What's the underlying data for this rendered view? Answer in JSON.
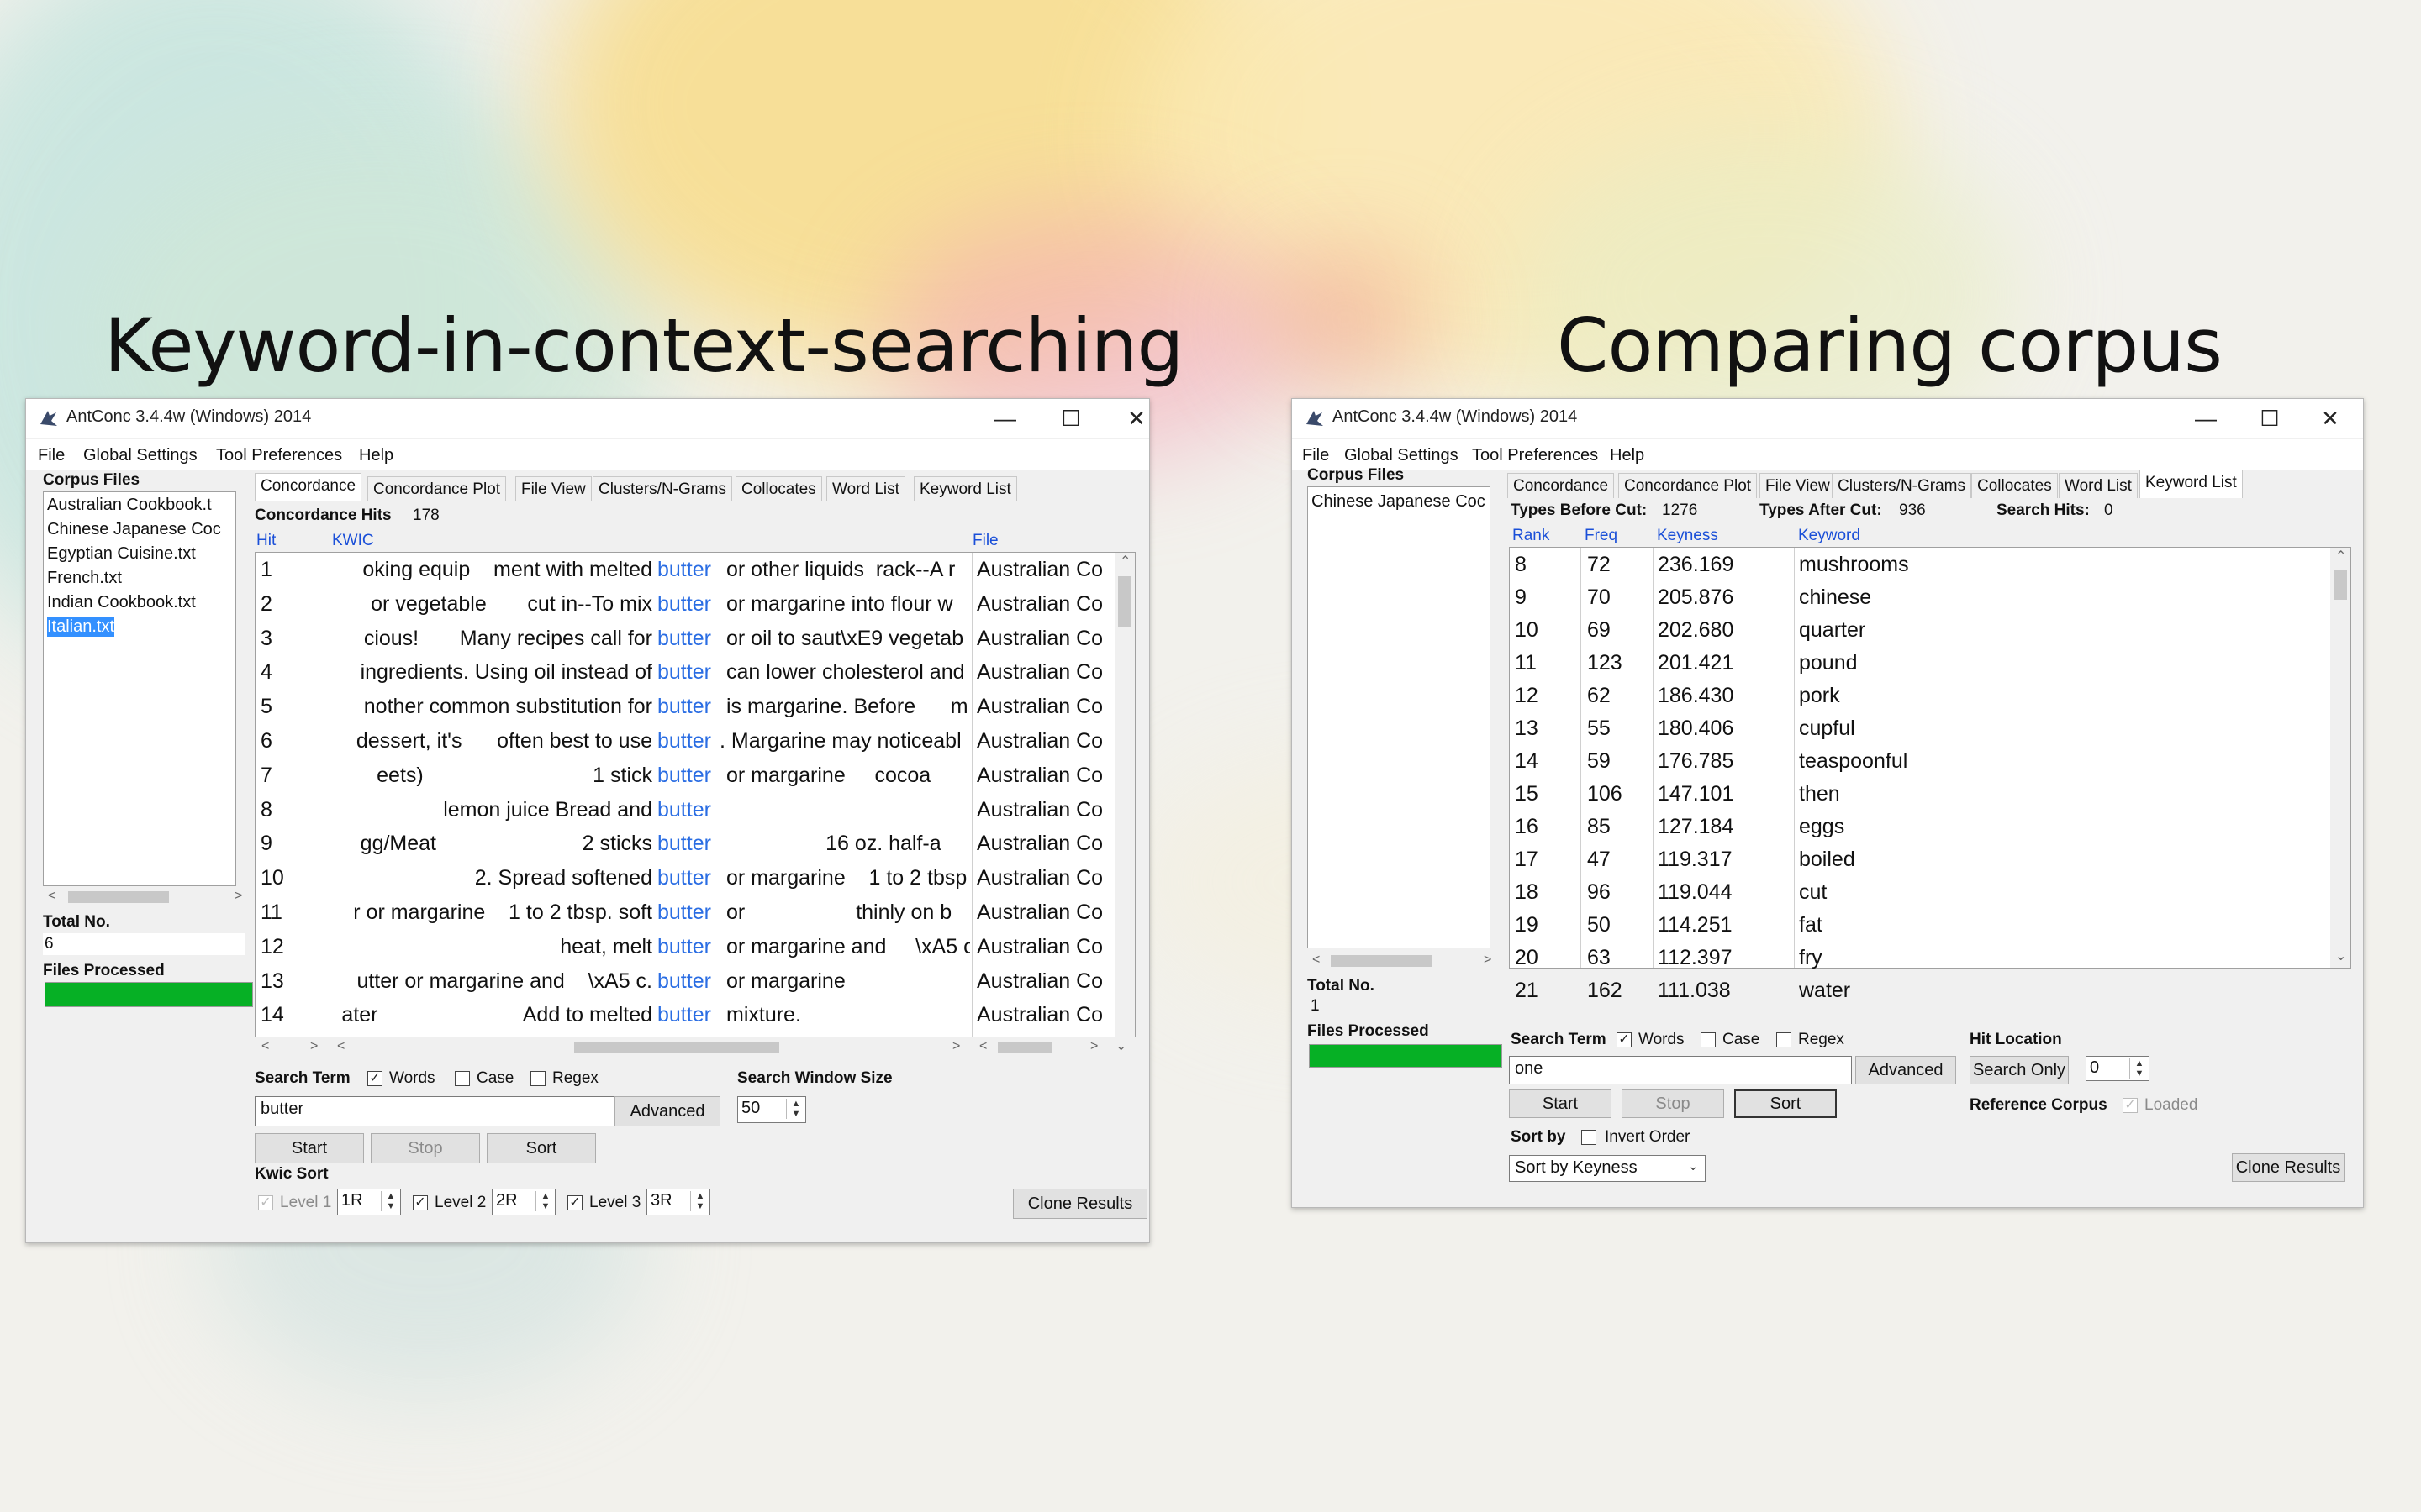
{
  "slide": {
    "left_title": "Keyword-in-context-searching",
    "right_title": "Comparing corpus"
  },
  "colors": {
    "progress": "#06b025",
    "selection": "#3390ff",
    "keyword": "#2a6de3",
    "column_header": "#1a4fd8"
  },
  "left_window": {
    "title": "AntConc 3.4.4w (Windows) 2014",
    "menu": [
      "File",
      "Global Settings",
      "Tool Preferences",
      "Help"
    ],
    "corpus_files_label": "Corpus Files",
    "corpus_files": [
      "Australian Cookbook.t",
      "Chinese Japanese Coc",
      "Egyptian Cuisine.txt",
      "French.txt",
      "Indian Cookbook.txt",
      "Italian.txt"
    ],
    "selected_file": "Italian.txt",
    "total_no_label": "Total No.",
    "total_no": "6",
    "files_processed_label": "Files Processed",
    "files_processed_progress": 1.0,
    "tabs": [
      "Concordance",
      "Concordance Plot",
      "File View",
      "Clusters/N-Grams",
      "Collocates",
      "Word List",
      "Keyword List"
    ],
    "active_tab": "Concordance",
    "hits_label": "Concordance Hits",
    "hits": "178",
    "columns": {
      "hit": "Hit",
      "kwic": "KWIC",
      "file": "File"
    },
    "rows": [
      {
        "hit": "1",
        "left": "oking equip    ment with melted",
        "kw": "butter",
        "right": "or other liquids  rack--A r",
        "file": "Australian Co"
      },
      {
        "hit": "2",
        "left": "or vegetable       cut in--To mix",
        "kw": "butter",
        "right": "or margarine into flour w",
        "file": "Australian Co"
      },
      {
        "hit": "3",
        "left": "cious!       Many recipes call for",
        "kw": "butter",
        "right": "or oil to saut\\xE9 vegetab",
        "file": "Australian Co"
      },
      {
        "hit": "4",
        "left": "ingredients. Using oil instead of",
        "kw": "butter",
        "right": "can lower cholesterol and",
        "file": "Australian Co"
      },
      {
        "hit": "5",
        "left": "nother common substitution for",
        "kw": "butter",
        "right": "is margarine. Before      m",
        "file": "Australian Co"
      },
      {
        "hit": "6",
        "left": "dessert, it's      often best to use",
        "kw": "butter",
        "right": ". Margarine may noticeabl",
        "file": "Australian Co"
      },
      {
        "hit": "7",
        "left": "eets)                             1 stick",
        "kw": "butter",
        "right": "or margarine     cocoa",
        "file": "Australian Co"
      },
      {
        "hit": "8",
        "left": "lemon juice Bread and",
        "kw": "butter",
        "right": "",
        "file": "Australian Co"
      },
      {
        "hit": "9",
        "left": "gg/Meat                         2 sticks",
        "kw": "butter",
        "right": "                 16 oz. half-a",
        "file": "Australian Co"
      },
      {
        "hit": "10",
        "left": "2. Spread softened",
        "kw": "butter",
        "right": "or margarine    1 to 2 tbsp",
        "file": "Australian Co"
      },
      {
        "hit": "11",
        "left": "r or margarine    1 to 2 tbsp. soft",
        "kw": "butter",
        "right": "or                   thinly on b",
        "file": "Australian Co"
      },
      {
        "hit": "12",
        "left": "heat, melt",
        "kw": "butter",
        "right": "or margarine and     \\xA5 c",
        "file": "Australian Co"
      },
      {
        "hit": "13",
        "left": "utter or margarine and    \\xA5 c.",
        "kw": "butter",
        "right": "or margarine",
        "file": "Australian Co"
      },
      {
        "hit": "14",
        "left": "ater                         Add to melted",
        "kw": "butter",
        "right": "mixture.",
        "file": "Australian Co"
      }
    ],
    "search_term_label": "Search Term",
    "words_label": "Words",
    "case_label": "Case",
    "regex_label": "Regex",
    "search_value": "butter",
    "advanced_label": "Advanced",
    "window_size_label": "Search Window Size",
    "window_size": "50",
    "start_label": "Start",
    "stop_label": "Stop",
    "sort_label": "Sort",
    "kwic_sort_label": "Kwic Sort",
    "level1_label": "Level 1",
    "level1_value": "1R",
    "level2_label": "Level 2",
    "level2_value": "2R",
    "level3_label": "Level 3",
    "level3_value": "3R",
    "clone_label": "Clone Results"
  },
  "right_window": {
    "title": "AntConc 3.4.4w (Windows) 2014",
    "menu": [
      "File",
      "Global Settings",
      "Tool Preferences",
      "Help"
    ],
    "corpus_files_label": "Corpus Files",
    "corpus_files": [
      "Chinese Japanese Coc"
    ],
    "total_no_label": "Total No.",
    "total_no": "1",
    "files_processed_label": "Files Processed",
    "files_processed_progress": 1.0,
    "tabs": [
      "Concordance",
      "Concordance Plot",
      "File View",
      "Clusters/N-Grams",
      "Collocates",
      "Word List",
      "Keyword List"
    ],
    "active_tab": "Keyword List",
    "types_before_label": "Types Before Cut:",
    "types_before": "1276",
    "types_after_label": "Types After Cut:",
    "types_after": "936",
    "search_hits_label": "Search Hits:",
    "search_hits": "0",
    "columns": {
      "rank": "Rank",
      "freq": "Freq",
      "keyness": "Keyness",
      "keyword": "Keyword"
    },
    "rows": [
      {
        "rank": "8",
        "freq": "72",
        "keyness": "236.169",
        "keyword": "mushrooms"
      },
      {
        "rank": "9",
        "freq": "70",
        "keyness": "205.876",
        "keyword": "chinese"
      },
      {
        "rank": "10",
        "freq": "69",
        "keyness": "202.680",
        "keyword": "quarter"
      },
      {
        "rank": "11",
        "freq": "123",
        "keyness": "201.421",
        "keyword": "pound"
      },
      {
        "rank": "12",
        "freq": "62",
        "keyness": "186.430",
        "keyword": "pork"
      },
      {
        "rank": "13",
        "freq": "55",
        "keyness": "180.406",
        "keyword": "cupful"
      },
      {
        "rank": "14",
        "freq": "59",
        "keyness": "176.785",
        "keyword": "teaspoonful"
      },
      {
        "rank": "15",
        "freq": "106",
        "keyness": "147.101",
        "keyword": "then"
      },
      {
        "rank": "16",
        "freq": "85",
        "keyness": "127.184",
        "keyword": "eggs"
      },
      {
        "rank": "17",
        "freq": "47",
        "keyness": "119.317",
        "keyword": "boiled"
      },
      {
        "rank": "18",
        "freq": "96",
        "keyness": "119.044",
        "keyword": "cut"
      },
      {
        "rank": "19",
        "freq": "50",
        "keyness": "114.251",
        "keyword": "fat"
      },
      {
        "rank": "20",
        "freq": "63",
        "keyness": "112.397",
        "keyword": "fry"
      },
      {
        "rank": "21",
        "freq": "162",
        "keyness": "111.038",
        "keyword": "water"
      }
    ],
    "search_term_label": "Search Term",
    "words_label": "Words",
    "case_label": "Case",
    "regex_label": "Regex",
    "search_value": "one",
    "advanced_label": "Advanced",
    "hit_location_label": "Hit Location",
    "search_only_label": "Search Only",
    "hit_location_value": "0",
    "start_label": "Start",
    "stop_label": "Stop",
    "sort_label": "Sort",
    "reference_corpus_label": "Reference Corpus",
    "loaded_label": "Loaded",
    "sort_by_label": "Sort by",
    "invert_order_label": "Invert Order",
    "sort_by_value": "Sort by Keyness",
    "clone_label": "Clone Results"
  }
}
